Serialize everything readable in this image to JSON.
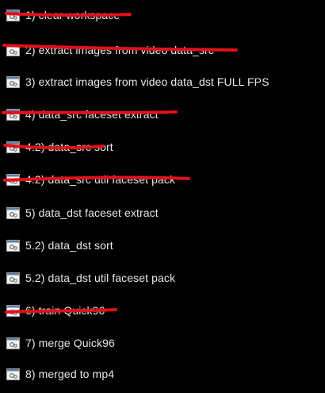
{
  "background_color": "#000000",
  "annotation_color": "#e0111b",
  "items": [
    {
      "label": "1) clear workspace",
      "icon": "batch-file-icon",
      "crossed_out": true
    },
    {
      "label": "2) extract images from video data_src",
      "icon": "batch-file-icon",
      "crossed_out": true
    },
    {
      "label": "3) extract images from video data_dst FULL FPS",
      "icon": "batch-file-icon",
      "crossed_out": false
    },
    {
      "label": "4) data_src faceset extract",
      "icon": "batch-file-icon",
      "crossed_out": true
    },
    {
      "label": "4.2) data_src sort",
      "icon": "batch-file-icon",
      "crossed_out": true
    },
    {
      "label": "4.2) data_src util faceset pack",
      "icon": "batch-file-icon",
      "crossed_out": true
    },
    {
      "label": "5) data_dst faceset extract",
      "icon": "batch-file-icon",
      "crossed_out": false
    },
    {
      "label": "5.2) data_dst sort",
      "icon": "batch-file-icon",
      "crossed_out": false
    },
    {
      "label": "5.2) data_dst util faceset pack",
      "icon": "batch-file-icon",
      "crossed_out": false
    },
    {
      "label": "6) train Quick96",
      "icon": "batch-file-icon",
      "crossed_out": true
    },
    {
      "label": "7) merge Quick96",
      "icon": "batch-file-icon",
      "crossed_out": false
    },
    {
      "label": "8) merged to mp4",
      "icon": "batch-file-icon",
      "crossed_out": false
    }
  ]
}
